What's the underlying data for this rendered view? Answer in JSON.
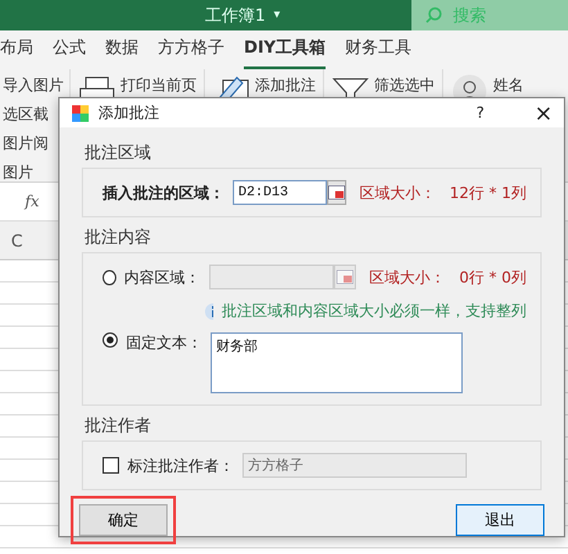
{
  "window": {
    "title": "工作簿1",
    "title_caret": "▾"
  },
  "search": {
    "placeholder": "搜索"
  },
  "ribbon_tabs": [
    {
      "label": "布局",
      "selected": false
    },
    {
      "label": "公式",
      "selected": false
    },
    {
      "label": "数据",
      "selected": false
    },
    {
      "label": "方方格子",
      "selected": false
    },
    {
      "label": "DIY工具箱",
      "selected": true
    },
    {
      "label": "财务工具",
      "selected": false
    }
  ],
  "ribbon_left_items": [
    "导入图片",
    "选区截",
    "图片阅"
  ],
  "ribbon_group_label": "图片",
  "ribbon_buttons": [
    {
      "label": "打印当前页",
      "kind": "printer"
    },
    {
      "label": "添加批注",
      "kind": "pencil"
    },
    {
      "label": "筛选选中",
      "kind": "filter"
    },
    {
      "label": "姓名",
      "kind": "person"
    }
  ],
  "formula_bar": {
    "fx": "fx"
  },
  "column_header": "C",
  "dialog": {
    "title": "添加批注",
    "help": "?",
    "close": "×",
    "range_group": {
      "title": "批注区域",
      "label": "插入批注的区域：",
      "value": "D2:D13",
      "size_label": "区域大小：",
      "size_value": "12行 * 1列"
    },
    "content_group": {
      "title": "批注内容",
      "options": [
        {
          "kind": "range",
          "label": "内容区域：",
          "selected": false,
          "size_label": "区域大小：",
          "size_value": "0行 * 0列"
        },
        {
          "kind": "text",
          "label": "固定文本：",
          "selected": true,
          "value": "财务部"
        }
      ],
      "note": "批注区域和内容区域大小必须一样，支持整列"
    },
    "author_group": {
      "title": "批注作者",
      "label": "标注批注作者：",
      "checked": false,
      "value": "方方格子"
    },
    "buttons": [
      {
        "label": "确定",
        "default": false,
        "highlighted": true
      },
      {
        "label": "退出",
        "default": true,
        "highlighted": false
      }
    ]
  }
}
